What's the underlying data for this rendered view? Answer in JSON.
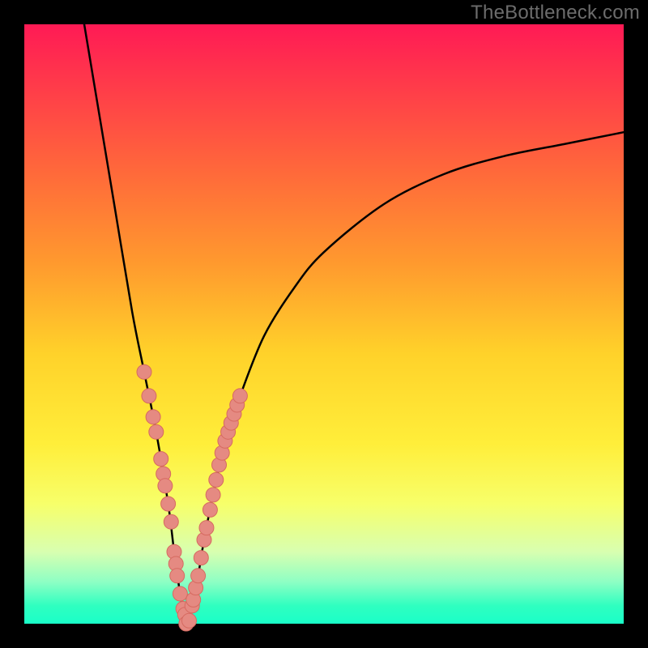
{
  "watermark": "TheBottleneck.com",
  "colors": {
    "background": "#000000",
    "curve": "#000000",
    "marker_fill": "#e58a82",
    "marker_stroke": "#d66a60"
  },
  "chart_data": {
    "type": "line",
    "title": "",
    "xlabel": "",
    "ylabel": "",
    "xlim": [
      0,
      100
    ],
    "ylim": [
      0,
      100
    ],
    "grid": false,
    "curve_note": "V-shaped bottleneck curve; minimum near x≈27, y≈0. Left branch steep, right branch shallow-asymptotic.",
    "series": [
      {
        "name": "bottleneck-curve",
        "x": [
          10,
          12,
          15,
          18,
          20,
          22,
          24,
          25,
          26,
          27,
          28,
          29,
          30,
          32,
          34,
          36,
          40,
          45,
          50,
          60,
          70,
          80,
          90,
          100
        ],
        "y": [
          100,
          88,
          70,
          52,
          42,
          32,
          20,
          12,
          5,
          0,
          3,
          8,
          14,
          24,
          32,
          38,
          48,
          56,
          62,
          70,
          75,
          78,
          80,
          82
        ]
      }
    ],
    "markers": {
      "name": "sample-points",
      "note": "salmon dots clustered on both branches near the valley",
      "points": [
        {
          "x": 20.0,
          "y": 42.0
        },
        {
          "x": 20.8,
          "y": 38.0
        },
        {
          "x": 21.5,
          "y": 34.5
        },
        {
          "x": 22.0,
          "y": 32.0
        },
        {
          "x": 22.8,
          "y": 27.5
        },
        {
          "x": 23.2,
          "y": 25.0
        },
        {
          "x": 23.5,
          "y": 23.0
        },
        {
          "x": 24.0,
          "y": 20.0
        },
        {
          "x": 24.5,
          "y": 17.0
        },
        {
          "x": 25.0,
          "y": 12.0
        },
        {
          "x": 25.3,
          "y": 10.0
        },
        {
          "x": 25.5,
          "y": 8.0
        },
        {
          "x": 26.0,
          "y": 5.0
        },
        {
          "x": 26.5,
          "y": 2.5
        },
        {
          "x": 26.8,
          "y": 1.5
        },
        {
          "x": 27.0,
          "y": 0.0
        },
        {
          "x": 27.5,
          "y": 0.5
        },
        {
          "x": 28.0,
          "y": 3.0
        },
        {
          "x": 28.2,
          "y": 4.0
        },
        {
          "x": 28.6,
          "y": 6.0
        },
        {
          "x": 29.0,
          "y": 8.0
        },
        {
          "x": 29.5,
          "y": 11.0
        },
        {
          "x": 30.0,
          "y": 14.0
        },
        {
          "x": 30.4,
          "y": 16.0
        },
        {
          "x": 31.0,
          "y": 19.0
        },
        {
          "x": 31.5,
          "y": 21.5
        },
        {
          "x": 32.0,
          "y": 24.0
        },
        {
          "x": 32.5,
          "y": 26.5
        },
        {
          "x": 33.0,
          "y": 28.5
        },
        {
          "x": 33.5,
          "y": 30.5
        },
        {
          "x": 34.0,
          "y": 32.0
        },
        {
          "x": 34.5,
          "y": 33.5
        },
        {
          "x": 35.0,
          "y": 35.0
        },
        {
          "x": 35.5,
          "y": 36.5
        },
        {
          "x": 36.0,
          "y": 38.0
        }
      ]
    }
  }
}
